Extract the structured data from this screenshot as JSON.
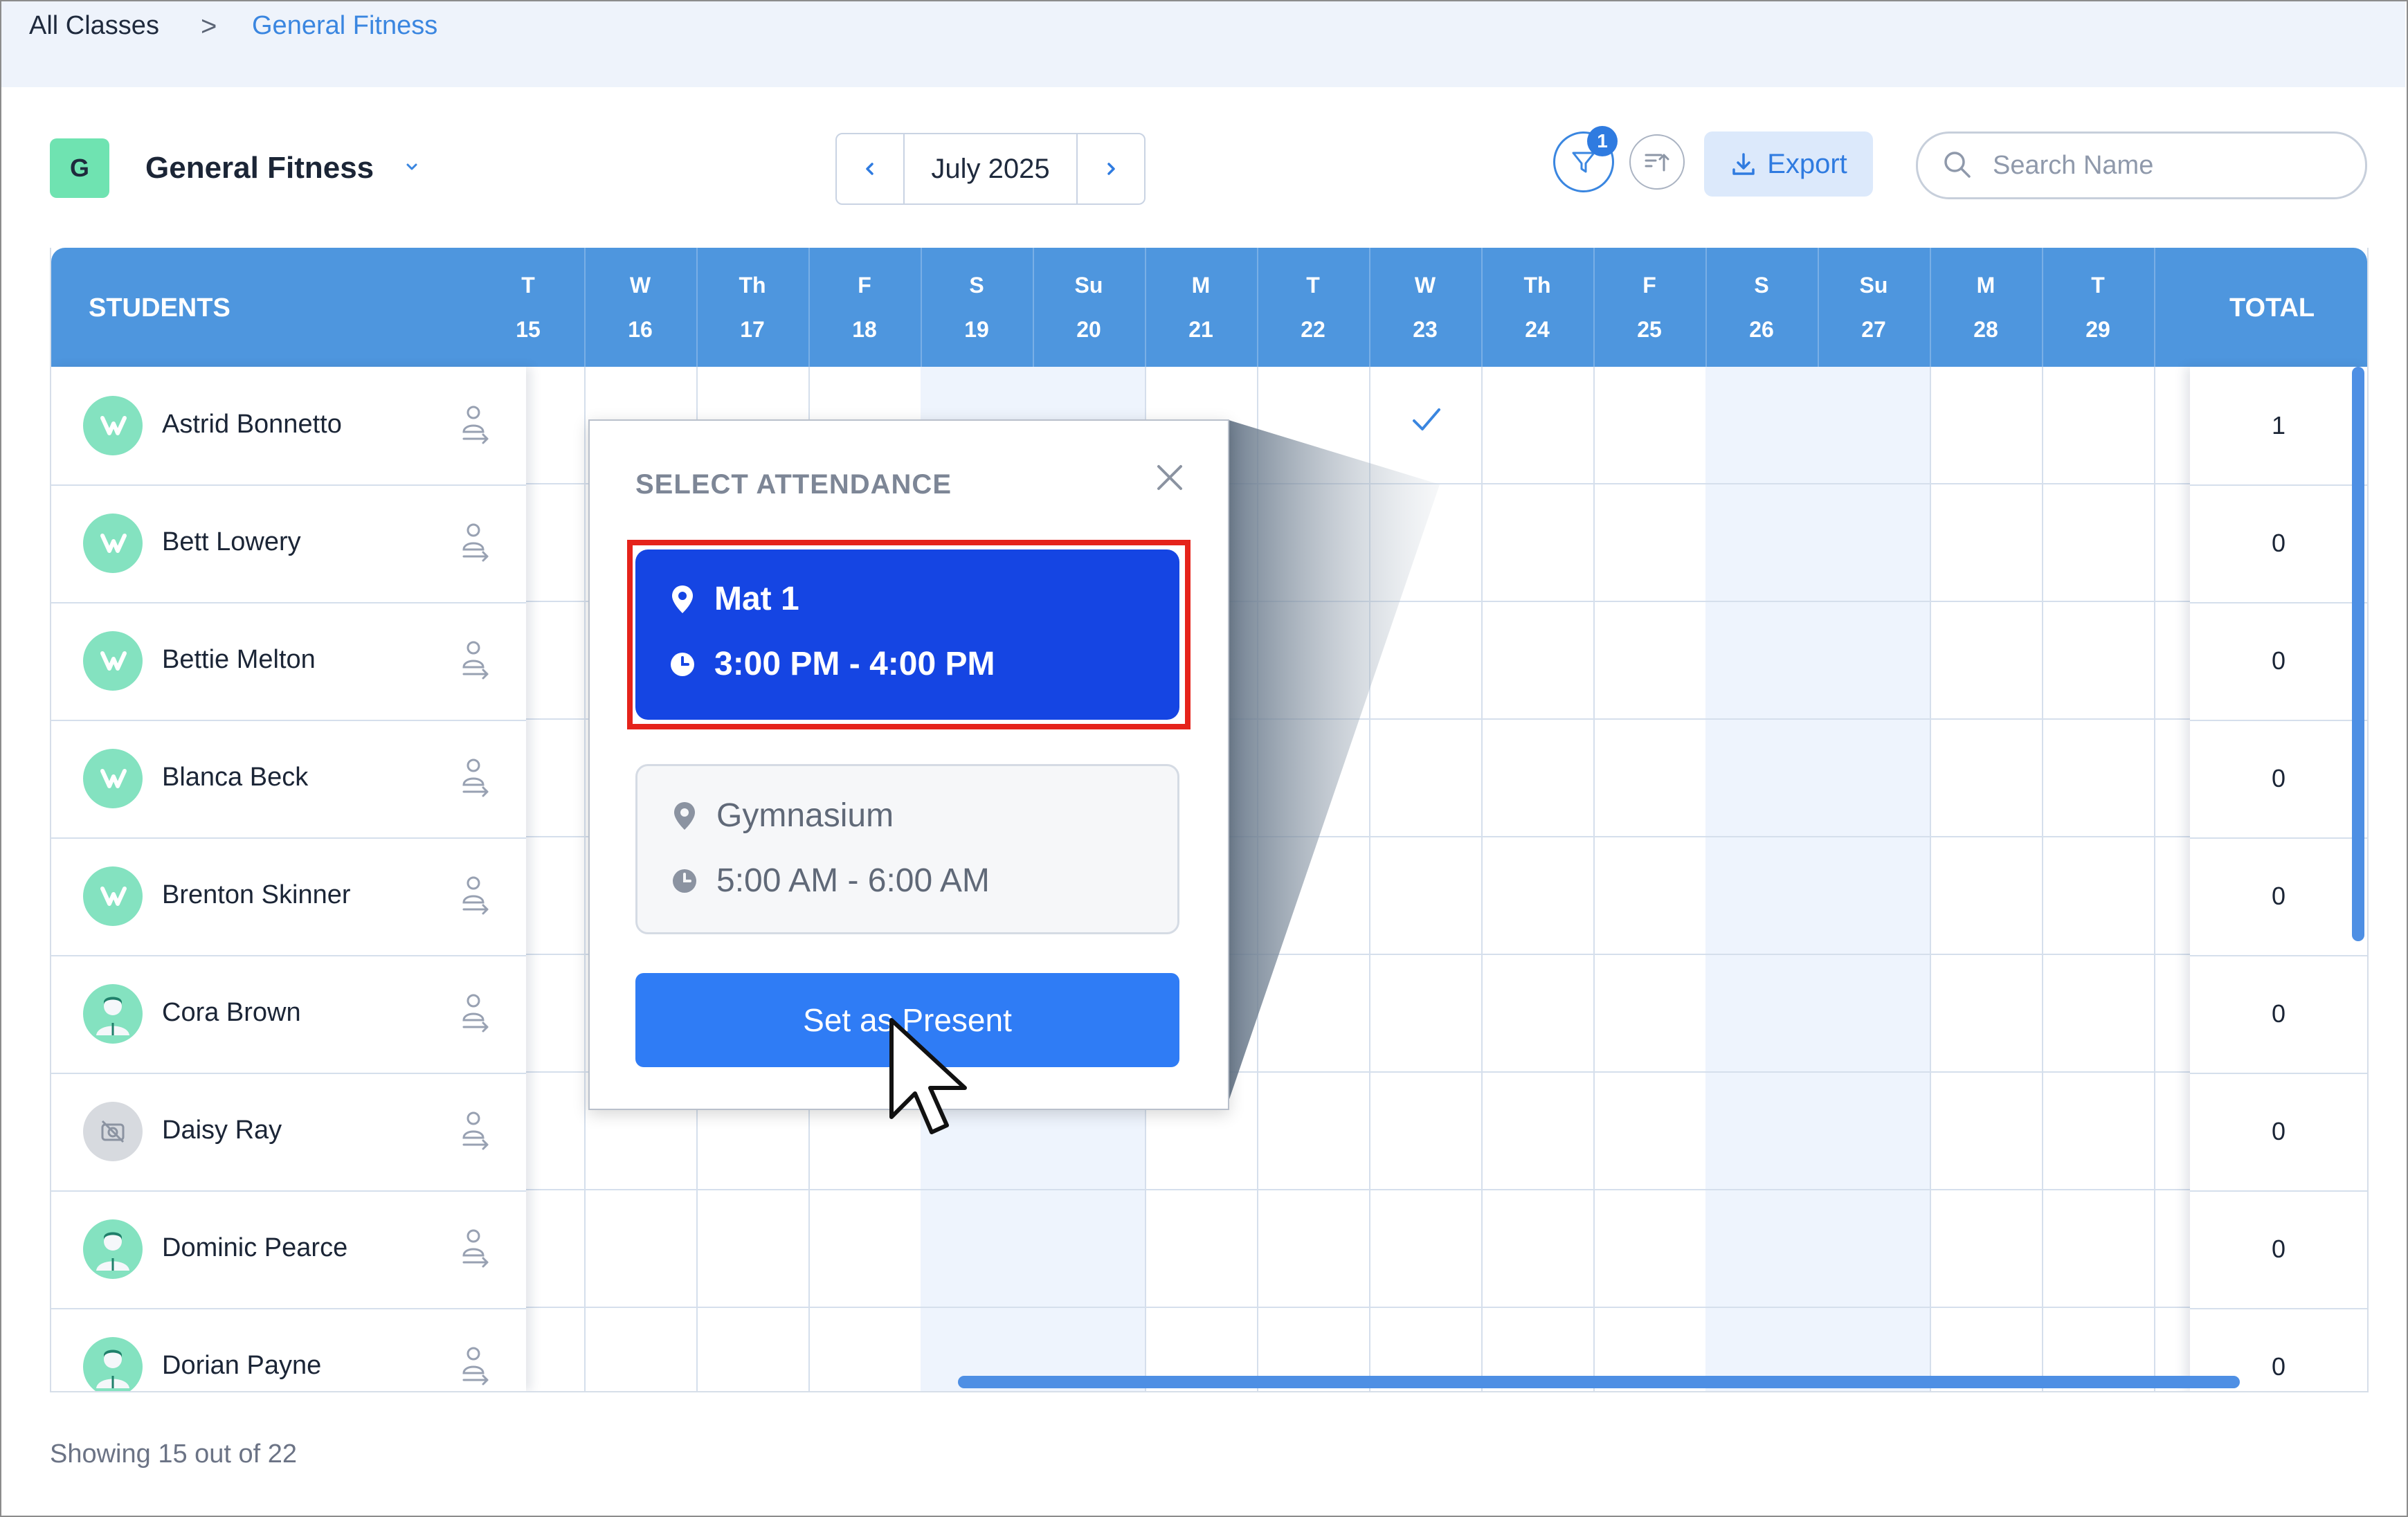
{
  "breadcrumb": {
    "root": "All Classes",
    "separator": ">",
    "current": "General Fitness"
  },
  "header": {
    "class_initial": "G",
    "class_name": "General Fitness",
    "month": "July 2025"
  },
  "toolbar": {
    "filter_count": "1",
    "export_label": "Export",
    "search_placeholder": "Search Name"
  },
  "grid": {
    "students_header": "STUDENTS",
    "total_header": "TOTAL",
    "days": [
      {
        "dow": "T",
        "num": "15"
      },
      {
        "dow": "W",
        "num": "16"
      },
      {
        "dow": "Th",
        "num": "17"
      },
      {
        "dow": "F",
        "num": "18"
      },
      {
        "dow": "S",
        "num": "19"
      },
      {
        "dow": "Su",
        "num": "20"
      },
      {
        "dow": "M",
        "num": "21"
      },
      {
        "dow": "T",
        "num": "22"
      },
      {
        "dow": "W",
        "num": "23"
      },
      {
        "dow": "Th",
        "num": "24"
      },
      {
        "dow": "F",
        "num": "25"
      },
      {
        "dow": "S",
        "num": "26"
      },
      {
        "dow": "Su",
        "num": "27"
      },
      {
        "dow": "M",
        "num": "28"
      },
      {
        "dow": "T",
        "num": "29"
      }
    ],
    "students": [
      {
        "name": "Astrid Bonnetto",
        "avatar": "logo-mint",
        "total": "1"
      },
      {
        "name": "Bett Lowery",
        "avatar": "logo-mint",
        "total": "0"
      },
      {
        "name": "Bettie Melton",
        "avatar": "logo-mint",
        "total": "0"
      },
      {
        "name": "Blanca Beck",
        "avatar": "logo-mint",
        "total": "0"
      },
      {
        "name": "Brenton Skinner",
        "avatar": "logo-mint",
        "total": "0"
      },
      {
        "name": "Cora Brown",
        "avatar": "person-mint",
        "total": "0"
      },
      {
        "name": "Daisy Ray",
        "avatar": "no-photo-grey",
        "total": "0"
      },
      {
        "name": "Dominic Pearce",
        "avatar": "person-mint",
        "total": "0"
      },
      {
        "name": "Dorian Payne",
        "avatar": "person-mint",
        "total": "0"
      }
    ],
    "checked": {
      "student": "Astrid Bonnetto",
      "day": "23"
    }
  },
  "footer": {
    "showing": "Showing 15 out of 22"
  },
  "popover": {
    "title": "SELECT ATTENDANCE",
    "slots": [
      {
        "location": "Mat 1",
        "time": "3:00 PM - 4:00 PM",
        "selected": true
      },
      {
        "location": "Gymnasium",
        "time": "5:00 AM - 6:00 AM",
        "selected": false
      }
    ],
    "action_label": "Set as Present"
  },
  "colors": {
    "accent": "#2f7cf5",
    "header_blue": "#4e96de",
    "selected_slot": "#1545e3",
    "highlight_border": "#e5231b",
    "class_badge": "#6fe3b1"
  }
}
